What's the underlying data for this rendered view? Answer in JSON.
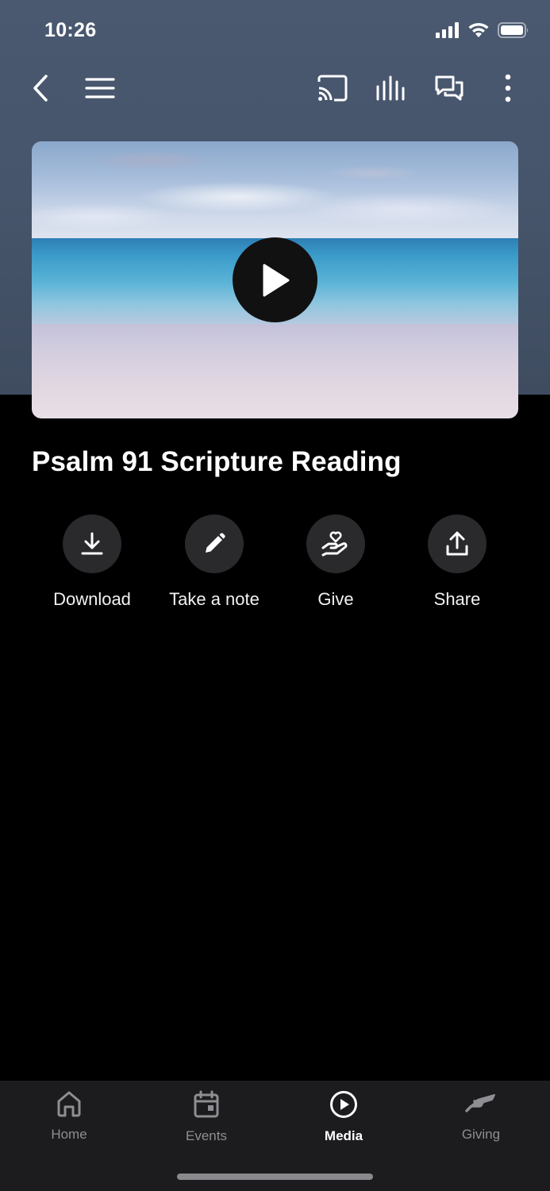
{
  "status_bar": {
    "time": "10:26"
  },
  "toolbar": {
    "back_icon": "chevron-left-icon",
    "menu_icon": "hamburger-menu-icon",
    "cast_icon": "cast-icon",
    "audio_icon": "audio-bars-icon",
    "chat_icon": "chat-bubbles-icon",
    "more_icon": "more-vertical-icon"
  },
  "video": {
    "play_icon": "play-icon"
  },
  "content": {
    "title": "Psalm 91 Scripture Reading"
  },
  "actions": [
    {
      "label": "Download",
      "icon": "download-icon"
    },
    {
      "label": "Take a note",
      "icon": "pencil-icon"
    },
    {
      "label": "Give",
      "icon": "hand-heart-icon"
    },
    {
      "label": "Share",
      "icon": "share-icon"
    }
  ],
  "tabs": [
    {
      "label": "Home",
      "icon": "home-icon",
      "active": false
    },
    {
      "label": "Events",
      "icon": "calendar-icon",
      "active": false
    },
    {
      "label": "Media",
      "icon": "play-circle-icon",
      "active": true
    },
    {
      "label": "Giving",
      "icon": "giving-hand-icon",
      "active": false
    }
  ],
  "colors": {
    "background": "#000000",
    "tab_bar": "#1c1c1e",
    "action_circle": "#2a2a2c",
    "inactive_tab": "#8e8e93"
  }
}
